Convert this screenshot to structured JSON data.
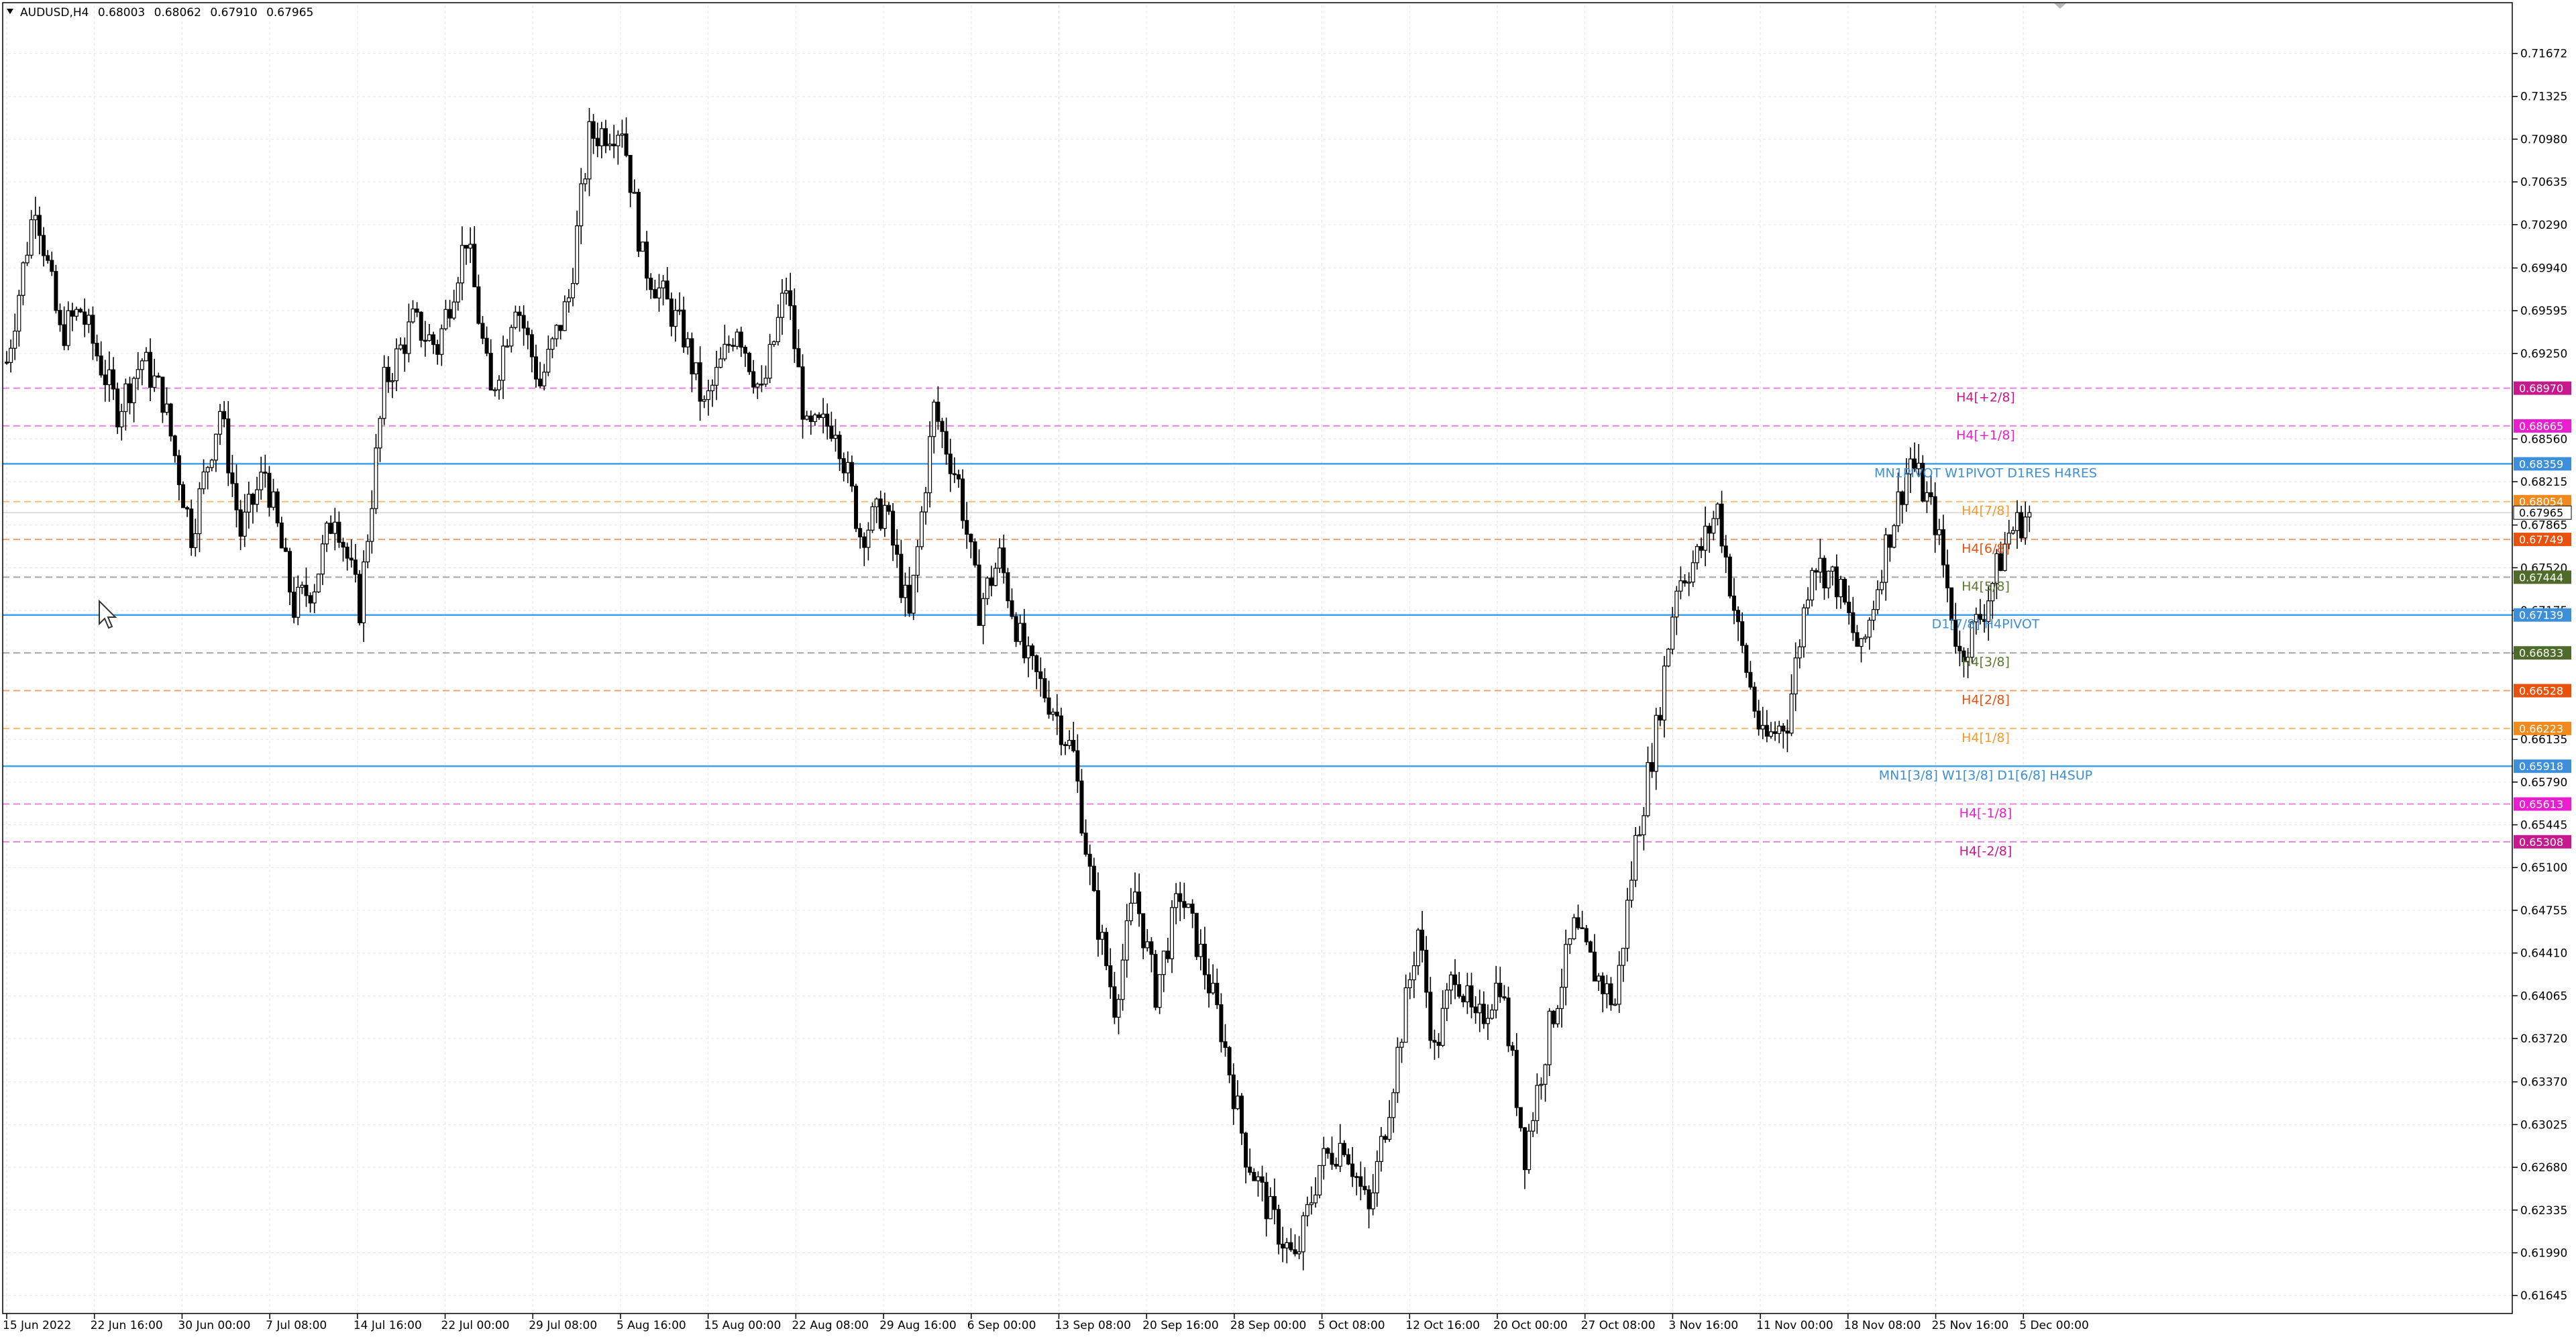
{
  "window": {
    "symbol_line": "AUDUSD,H4",
    "ohlc": [
      "0.68003",
      "0.68062",
      "0.67910",
      "0.67965"
    ]
  },
  "chart_data": {
    "type": "candlestick",
    "title": "AUDUSD,H4",
    "ylim": [
      0.615,
      0.7206
    ],
    "grid": true,
    "x_ticks": [
      "15 Jun 2022",
      "22 Jun 16:00",
      "30 Jun 00:00",
      "7 Jul 08:00",
      "14 Jul 16:00",
      "22 Jul 00:00",
      "29 Jul 08:00",
      "5 Aug 16:00",
      "15 Aug 00:00",
      "22 Aug 08:00",
      "29 Aug 16:00",
      "6 Sep 00:00",
      "13 Sep 08:00",
      "20 Sep 16:00",
      "28 Sep 00:00",
      "5 Oct 08:00",
      "12 Oct 16:00",
      "20 Oct 00:00",
      "27 Oct 08:00",
      "3 Nov 16:00",
      "11 Nov 00:00",
      "18 Nov 08:00",
      "25 Nov 16:00",
      "5 Dec 00:00"
    ],
    "y_ticks": [
      "0.71672",
      "0.71325",
      "0.70980",
      "0.70635",
      "0.70290",
      "0.69940",
      "0.69595",
      "0.69250",
      "0.68560",
      "0.68215",
      "0.67865",
      "0.67520",
      "0.67175",
      "0.66830",
      "0.66135",
      "0.65790",
      "0.65445",
      "0.65100",
      "0.64755",
      "0.64410",
      "0.64065",
      "0.63720",
      "0.63370",
      "0.63025",
      "0.62680",
      "0.62335",
      "0.61990",
      "0.61645"
    ],
    "current_price": "0.67965",
    "path_anchors": [
      [
        0,
        0.6918
      ],
      [
        7,
        0.705
      ],
      [
        13,
        0.694
      ],
      [
        18,
        0.696
      ],
      [
        27,
        0.688
      ],
      [
        33,
        0.692
      ],
      [
        38,
        0.689
      ],
      [
        45,
        0.678
      ],
      [
        52,
        0.688
      ],
      [
        57,
        0.678
      ],
      [
        63,
        0.683
      ],
      [
        70,
        0.672
      ],
      [
        75,
        0.674
      ],
      [
        80,
        0.68
      ],
      [
        86,
        0.672
      ],
      [
        92,
        0.69
      ],
      [
        99,
        0.695
      ],
      [
        105,
        0.693
      ],
      [
        112,
        0.702
      ],
      [
        118,
        0.689
      ],
      [
        124,
        0.697
      ],
      [
        130,
        0.69
      ],
      [
        137,
        0.697
      ],
      [
        142,
        0.71
      ],
      [
        150,
        0.711
      ],
      [
        155,
        0.7
      ],
      [
        165,
        0.694
      ],
      [
        170,
        0.688
      ],
      [
        178,
        0.695
      ],
      [
        184,
        0.689
      ],
      [
        190,
        0.698
      ],
      [
        195,
        0.686
      ],
      [
        202,
        0.687
      ],
      [
        208,
        0.678
      ],
      [
        214,
        0.68
      ],
      [
        220,
        0.671
      ],
      [
        226,
        0.688
      ],
      [
        232,
        0.682
      ],
      [
        237,
        0.672
      ],
      [
        242,
        0.676
      ],
      [
        248,
        0.668
      ],
      [
        255,
        0.664
      ],
      [
        260,
        0.66
      ],
      [
        265,
        0.648
      ],
      [
        270,
        0.64
      ],
      [
        275,
        0.649
      ],
      [
        280,
        0.641
      ],
      [
        286,
        0.649
      ],
      [
        291,
        0.644
      ],
      [
        296,
        0.638
      ],
      [
        302,
        0.628
      ],
      [
        308,
        0.623
      ],
      [
        314,
        0.619
      ],
      [
        320,
        0.627
      ],
      [
        326,
        0.629
      ],
      [
        332,
        0.623
      ],
      [
        338,
        0.634
      ],
      [
        344,
        0.646
      ],
      [
        348,
        0.636
      ],
      [
        353,
        0.643
      ],
      [
        358,
        0.638
      ],
      [
        364,
        0.642
      ],
      [
        370,
        0.628
      ],
      [
        376,
        0.638
      ],
      [
        382,
        0.646
      ],
      [
        388,
        0.642
      ],
      [
        392,
        0.64
      ],
      [
        397,
        0.653
      ],
      [
        402,
        0.662
      ],
      [
        407,
        0.674
      ],
      [
        412,
        0.676
      ],
      [
        417,
        0.68
      ],
      [
        422,
        0.67
      ],
      [
        428,
        0.661
      ],
      [
        434,
        0.663
      ],
      [
        440,
        0.676
      ],
      [
        446,
        0.674
      ],
      [
        452,
        0.668
      ],
      [
        458,
        0.677
      ],
      [
        464,
        0.684
      ],
      [
        470,
        0.679
      ],
      [
        476,
        0.668
      ],
      [
        482,
        0.672
      ],
      [
        488,
        0.678
      ],
      [
        493,
        0.6797
      ]
    ],
    "series": [
      {
        "name": "H4[+2/8]",
        "value": 0.6897,
        "price_label": "0.68970",
        "style": "dash",
        "color": "#e884e2",
        "tag_color": "#c8188e",
        "label_color": "#c8188e"
      },
      {
        "name": "H4[+1/8]",
        "value": 0.68665,
        "price_label": "0.68665",
        "style": "dash",
        "color": "#e884e2",
        "tag_color": "#e81ed0",
        "label_color": "#e81ed0"
      },
      {
        "name": "MN1PIVOT W1PIVOT D1RES H4RES",
        "value": 0.68359,
        "price_label": "0.68359",
        "style": "solid",
        "color": "#3fa0ec",
        "tag_color": "#3c8fd8",
        "label_color": "#3c8fd8"
      },
      {
        "name": "H4[7/8]",
        "value": 0.68054,
        "price_label": "0.68054",
        "style": "dash",
        "color": "#f4be70",
        "tag_color": "#f08a1c",
        "label_color": "#f29a2c"
      },
      {
        "name": "H4[6/8]",
        "value": 0.67749,
        "price_label": "0.67749",
        "style": "dash",
        "color": "#f0a070",
        "tag_color": "#e8520e",
        "label_color": "#e8520e"
      },
      {
        "name": "H4[5/8]",
        "value": 0.67444,
        "price_label": "0.67444",
        "style": "dash",
        "color": "#a0a8a0",
        "tag_color": "#4e6b2a",
        "label_color": "#5a7a30"
      },
      {
        "name": "D1[7/8] H4PIVOT",
        "value": 0.67139,
        "price_label": "0.67139",
        "style": "solid",
        "color": "#3fa0ec",
        "tag_color": "#3c8fd8",
        "label_color": "#3c8fd8"
      },
      {
        "name": "H4[3/8]",
        "value": 0.66833,
        "price_label": "0.66833",
        "style": "dash",
        "color": "#a0a8a0",
        "tag_color": "#4e6b2a",
        "label_color": "#5a7a30"
      },
      {
        "name": "H4[2/8]",
        "value": 0.66528,
        "price_label": "0.66528",
        "style": "dash",
        "color": "#f0a070",
        "tag_color": "#e8520e",
        "label_color": "#e8520e"
      },
      {
        "name": "H4[1/8]",
        "value": 0.66223,
        "price_label": "0.66223",
        "style": "dash",
        "color": "#f4be70",
        "tag_color": "#f08a1c",
        "label_color": "#f29a2c"
      },
      {
        "name": "MN1[3/8] W1[3/8] D1[6/8] H4SUP",
        "value": 0.65918,
        "price_label": "0.65918",
        "style": "solid",
        "color": "#3fa0ec",
        "tag_color": "#3c8fd8",
        "label_color": "#3c8fd8"
      },
      {
        "name": "H4[-1/8]",
        "value": 0.65613,
        "price_label": "0.65613",
        "style": "dash",
        "color": "#e884e2",
        "tag_color": "#e81ed0",
        "label_color": "#e81ed0"
      },
      {
        "name": "H4[-2/8]",
        "value": 0.65308,
        "price_label": "0.65308",
        "style": "dash",
        "color": "#e884e2",
        "tag_color": "#c8188e",
        "label_color": "#c8188e"
      }
    ]
  }
}
